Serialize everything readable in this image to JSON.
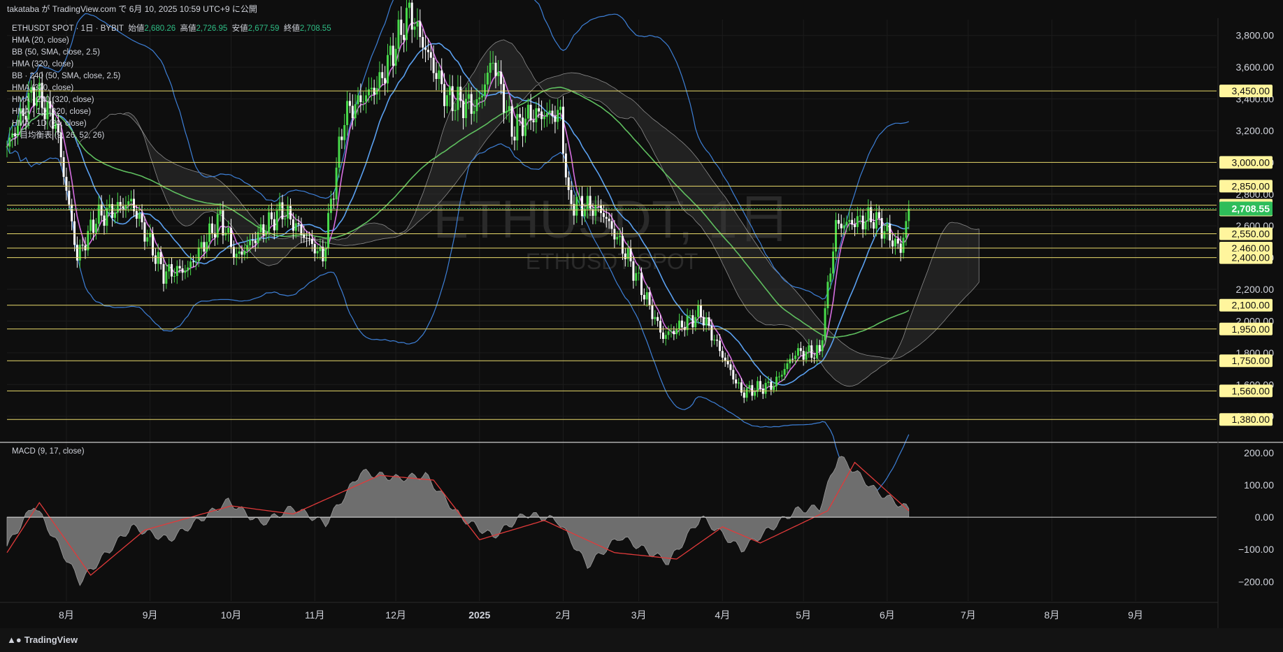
{
  "header": {
    "text": "takataba が TradingView.com で 6月 10, 2025 10:59 UTC+9 に公開"
  },
  "footer": {
    "brand": "TradingView",
    "logo_icon": "tradingview-logo-icon"
  },
  "legend": {
    "symbol": "ETHUSDT SPOT · 1日 · BYBIT",
    "open_label": "始値",
    "open": "2,680.26",
    "high_label": "高値",
    "high": "2,726.95",
    "low_label": "安値",
    "low": "2,677.59",
    "close_label": "終値",
    "close": "2,708.55",
    "indicators": [
      "HMA (20, close)",
      "BB (50, SMA, close, 2.5)",
      "HMA (320, close)",
      "BB · 240 (50, SMA, close, 2.5)",
      "HMA (320, close)",
      "HMA · 240 (320, close)",
      "HMA · 1D (320, close)",
      "HMA · 1D (20, close)",
      "一目均衡表 (9, 26, 52, 26)"
    ]
  },
  "watermark": {
    "title": "ETHUSDT, 1日",
    "subtitle": "ETHUSDT SPOT"
  },
  "macd_label": "MACD (9, 17, close)",
  "colors": {
    "background": "#0e0e0e",
    "grid": "#1c1c1c",
    "hline": "#e8d96a",
    "candle_up": "#48d94a",
    "candle_down": "#ffffff",
    "hma20": "#d56ee0",
    "hma320": "#5fbf5f",
    "bb": "#3d7fd6",
    "bb_mid": "#5aa0f0",
    "ichimoku": "#8a8a8a",
    "macd_hist": "#6e6e6e",
    "macd_signal": "#e03a3a",
    "price_label_bg": "#fff59d",
    "last_price_bg": "#2ebd5a"
  },
  "chart_data": {
    "type": "candlestick",
    "symbol": "ETHUSDT",
    "timeframe": "1D",
    "y_axis": {
      "ylim": [
        1240,
        3900
      ],
      "ticks": [
        "1,400.00",
        "1,600.00",
        "1,800.00",
        "2,000.00",
        "2,200.00",
        "2,400.00",
        "2,600.00",
        "2,800.00",
        "3,000.00",
        "3,200.00",
        "3,400.00",
        "3,600.00",
        "3,800.00"
      ]
    },
    "x_axis": {
      "ticks": [
        "8月",
        "9月",
        "10月",
        "11月",
        "12月",
        "2025",
        "2月",
        "3月",
        "4月",
        "5月",
        "6月",
        "7月",
        "8月",
        "9月"
      ]
    },
    "last_price": {
      "value": 2708.55,
      "label": "2,708.55"
    },
    "horizontal_levels": [
      {
        "value": 3450,
        "label": "3,450.00"
      },
      {
        "value": 3000,
        "label": "3,000.00"
      },
      {
        "value": 2850,
        "label": "2,850.00"
      },
      {
        "value": 2730,
        "label": "2,730.00"
      },
      {
        "value": 2700,
        "label": "2,700.00"
      },
      {
        "value": 2550,
        "label": "2,550.00"
      },
      {
        "value": 2460,
        "label": "2,460.00"
      },
      {
        "value": 2400,
        "label": "2,400.00"
      },
      {
        "value": 2100,
        "label": "2,100.00"
      },
      {
        "value": 1950,
        "label": "1,950.00"
      },
      {
        "value": 1750,
        "label": "1,750.00"
      },
      {
        "value": 1560,
        "label": "1,560.00"
      },
      {
        "value": 1380,
        "label": "1,380.00"
      }
    ],
    "price_path": [
      [
        "2024-07-10",
        3100
      ],
      [
        "2024-07-20",
        3450
      ],
      [
        "2024-07-28",
        3250
      ],
      [
        "2024-08-05",
        2400
      ],
      [
        "2024-08-12",
        2650
      ],
      [
        "2024-08-25",
        2750
      ],
      [
        "2024-09-06",
        2300
      ],
      [
        "2024-09-15",
        2330
      ],
      [
        "2024-09-27",
        2650
      ],
      [
        "2024-10-03",
        2400
      ],
      [
        "2024-10-14",
        2600
      ],
      [
        "2024-10-20",
        2700
      ],
      [
        "2024-11-04",
        2400
      ],
      [
        "2024-11-12",
        3300
      ],
      [
        "2024-11-25",
        3500
      ],
      [
        "2024-12-06",
        3950
      ],
      [
        "2024-12-20",
        3400
      ],
      [
        "2024-12-31",
        3350
      ],
      [
        "2025-01-06",
        3650
      ],
      [
        "2025-01-13",
        3200
      ],
      [
        "2025-01-20",
        3300
      ],
      [
        "2025-01-31",
        3300
      ],
      [
        "2025-02-03",
        2750
      ],
      [
        "2025-02-15",
        2700
      ],
      [
        "2025-02-25",
        2400
      ],
      [
        "2025-03-10",
        1900
      ],
      [
        "2025-03-24",
        2050
      ],
      [
        "2025-04-08",
        1550
      ],
      [
        "2025-04-20",
        1600
      ],
      [
        "2025-04-28",
        1800
      ],
      [
        "2025-05-07",
        1800
      ],
      [
        "2025-05-13",
        2600
      ],
      [
        "2025-05-27",
        2650
      ],
      [
        "2025-06-06",
        2450
      ],
      [
        "2025-06-09",
        2708.55
      ]
    ],
    "macd": {
      "ylim": [
        -260,
        230
      ],
      "ticks": [
        "200.00",
        "100.00",
        "0.00",
        "−100.00",
        "−200.00"
      ],
      "histogram_path": [
        [
          "2024-07-10",
          -90
        ],
        [
          "2024-07-20",
          40
        ],
        [
          "2024-08-06",
          -200
        ],
        [
          "2024-08-25",
          -30
        ],
        [
          "2024-09-08",
          -70
        ],
        [
          "2024-09-30",
          50
        ],
        [
          "2024-10-12",
          -20
        ],
        [
          "2024-10-24",
          30
        ],
        [
          "2024-11-05",
          -20
        ],
        [
          "2024-11-18",
          140
        ],
        [
          "2024-12-02",
          120
        ],
        [
          "2024-12-12",
          130
        ],
        [
          "2024-12-25",
          0
        ],
        [
          "2025-01-06",
          -60
        ],
        [
          "2025-01-18",
          10
        ],
        [
          "2025-01-30",
          -10
        ],
        [
          "2025-02-10",
          -150
        ],
        [
          "2025-02-22",
          -60
        ],
        [
          "2025-03-12",
          -140
        ],
        [
          "2025-03-24",
          0
        ],
        [
          "2025-04-08",
          -100
        ],
        [
          "2025-04-28",
          20
        ],
        [
          "2025-05-07",
          30
        ],
        [
          "2025-05-14",
          190
        ],
        [
          "2025-05-28",
          80
        ],
        [
          "2025-06-09",
          25
        ]
      ],
      "signal_path": [
        [
          "2024-07-10",
          -110
        ],
        [
          "2024-07-22",
          45
        ],
        [
          "2024-08-10",
          -180
        ],
        [
          "2024-08-30",
          -40
        ],
        [
          "2024-10-01",
          35
        ],
        [
          "2024-10-24",
          10
        ],
        [
          "2024-11-25",
          130
        ],
        [
          "2024-12-15",
          115
        ],
        [
          "2025-01-01",
          -70
        ],
        [
          "2025-01-25",
          -10
        ],
        [
          "2025-02-20",
          -110
        ],
        [
          "2025-03-15",
          -130
        ],
        [
          "2025-04-01",
          -30
        ],
        [
          "2025-04-15",
          -80
        ],
        [
          "2025-05-10",
          20
        ],
        [
          "2025-05-20",
          170
        ],
        [
          "2025-06-09",
          20
        ]
      ]
    }
  }
}
